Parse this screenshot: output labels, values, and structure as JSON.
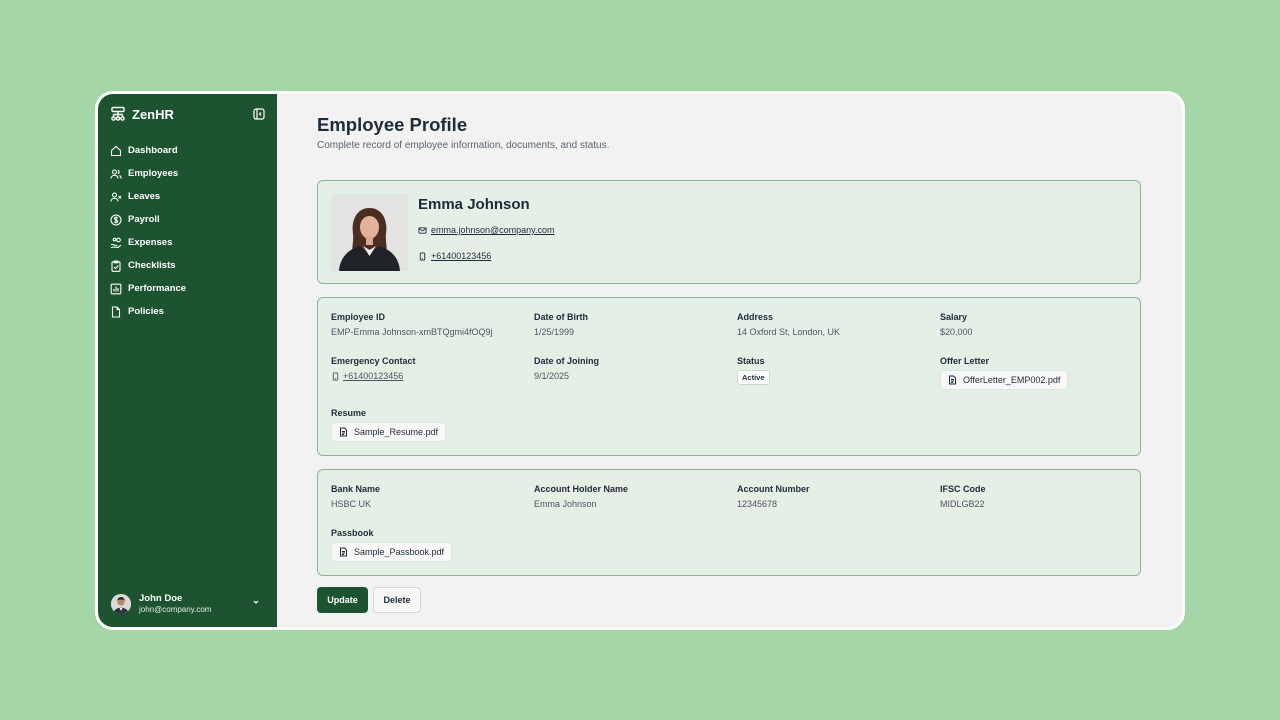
{
  "app": {
    "name": "ZenHR"
  },
  "sidebar": {
    "items": [
      {
        "label": "Dashboard",
        "icon": "home-icon"
      },
      {
        "label": "Employees",
        "icon": "users-icon"
      },
      {
        "label": "Leaves",
        "icon": "user-x-icon"
      },
      {
        "label": "Payroll",
        "icon": "dollar-circle-icon"
      },
      {
        "label": "Expenses",
        "icon": "hand-coins-icon"
      },
      {
        "label": "Checklists",
        "icon": "clipboard-check-icon"
      },
      {
        "label": "Performance",
        "icon": "bar-chart-icon"
      },
      {
        "label": "Policies",
        "icon": "file-icon"
      }
    ],
    "user": {
      "name": "John Doe",
      "email": "john@company.com"
    }
  },
  "page": {
    "title": "Employee Profile",
    "subtitle": "Complete record of employee information, documents, and status."
  },
  "profile": {
    "name": "Emma Johnson",
    "email": "emma.johnson@company.com",
    "phone": "+61400123456"
  },
  "details": {
    "employee_id": {
      "label": "Employee ID",
      "value": "EMP-Emma Johnson-xmBTQgmi4fOQ9j"
    },
    "dob": {
      "label": "Date of Birth",
      "value": "1/25/1999"
    },
    "address": {
      "label": "Address",
      "value": "14 Oxford St, London, UK"
    },
    "salary": {
      "label": "Salary",
      "value": "$20,000"
    },
    "emergency": {
      "label": "Emergency Contact",
      "value": "+61400123456"
    },
    "doj": {
      "label": "Date of Joining",
      "value": "9/1/2025"
    },
    "status": {
      "label": "Status",
      "value": "Active"
    },
    "offer": {
      "label": "Offer Letter",
      "value": "OfferLetter_EMP002.pdf"
    },
    "resume": {
      "label": "Resume",
      "value": "Sample_Resume.pdf"
    }
  },
  "bank": {
    "bank_name": {
      "label": "Bank Name",
      "value": "HSBC UK"
    },
    "holder": {
      "label": "Account Holder Name",
      "value": "Emma Johnson"
    },
    "number": {
      "label": "Account Number",
      "value": "12345678"
    },
    "ifsc": {
      "label": "IFSC Code",
      "value": "MIDLGB22"
    },
    "passbook": {
      "label": "Passbook",
      "value": "Sample_Passbook.pdf"
    }
  },
  "actions": {
    "update": "Update",
    "delete": "Delete"
  },
  "colors": {
    "sidebar": "#1e5331",
    "card": "#e4efe6",
    "background": "#a5d6a7"
  }
}
